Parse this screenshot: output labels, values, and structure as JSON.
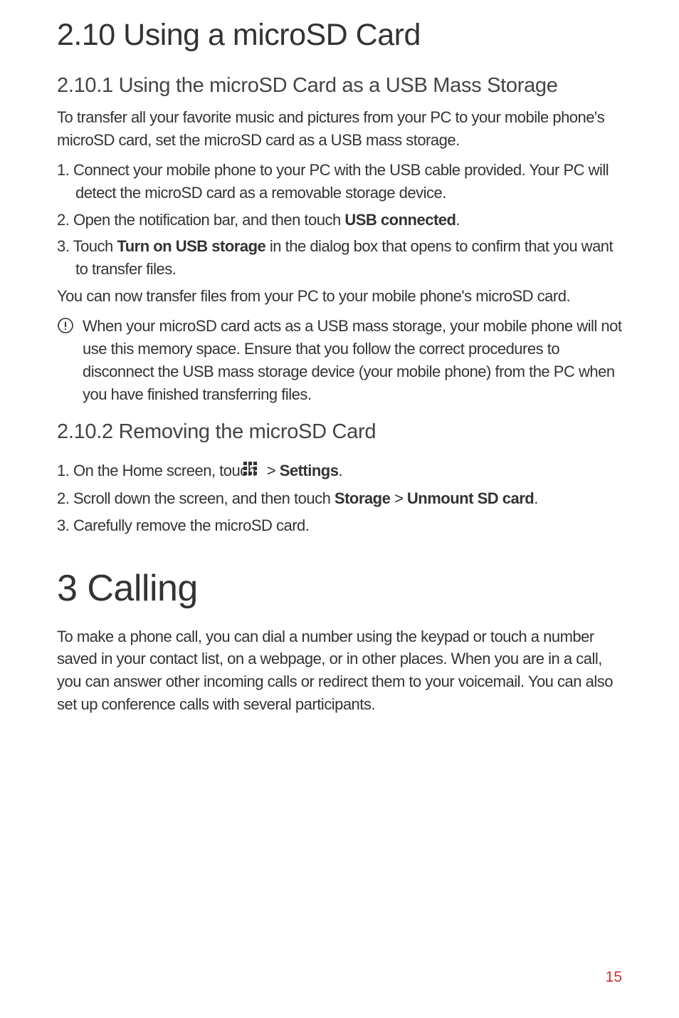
{
  "section_2_10": {
    "title": "2.10  Using a microSD Card",
    "sub1": {
      "title": "2.10.1  Using the microSD Card as a USB Mass Storage",
      "intro": "To transfer all your favorite music and pictures from your PC to your mobile phone's microSD card, set the microSD card as a USB mass storage.",
      "step1_a": "1. Connect your mobile phone to your PC with the USB cable provided. Your PC will detect the microSD card as a removable storage device.",
      "step2_prefix": "2. Open the notification bar, and then touch ",
      "step2_bold": "USB connected",
      "step2_suffix": ".",
      "step3_prefix": "3. Touch ",
      "step3_bold": "Turn on USB storage",
      "step3_suffix": " in the dialog box that opens to confirm that you want to transfer files.",
      "after_steps": "You can now transfer files from your PC to your mobile phone's microSD card.",
      "note": "When your microSD card acts as a USB mass storage, your mobile phone will not use this memory space. Ensure that you follow the correct procedures to disconnect the USB mass storage device (your mobile phone) from the PC when you have finished transferring files."
    },
    "sub2": {
      "title": "2.10.2  Removing the microSD Card",
      "step1_prefix": "1. On the Home screen, touch ",
      "step1_mid": "  > ",
      "step1_bold": "Settings",
      "step1_suffix": ".",
      "step2_prefix": "2. Scroll down the screen, and then touch ",
      "step2_bold1": "Storage",
      "step2_mid": " > ",
      "step2_bold2": "Unmount SD card",
      "step2_suffix": ".",
      "step3": "3. Carefully remove the microSD card."
    }
  },
  "section_3": {
    "title": "3  Calling",
    "intro": "To make a phone call, you can dial a number using the keypad or touch a number saved in your contact list, on a webpage, or in other places. When you are in a call, you can answer other incoming calls or redirect them to your voicemail. You can also set up conference calls with several participants."
  },
  "page_number": "15"
}
